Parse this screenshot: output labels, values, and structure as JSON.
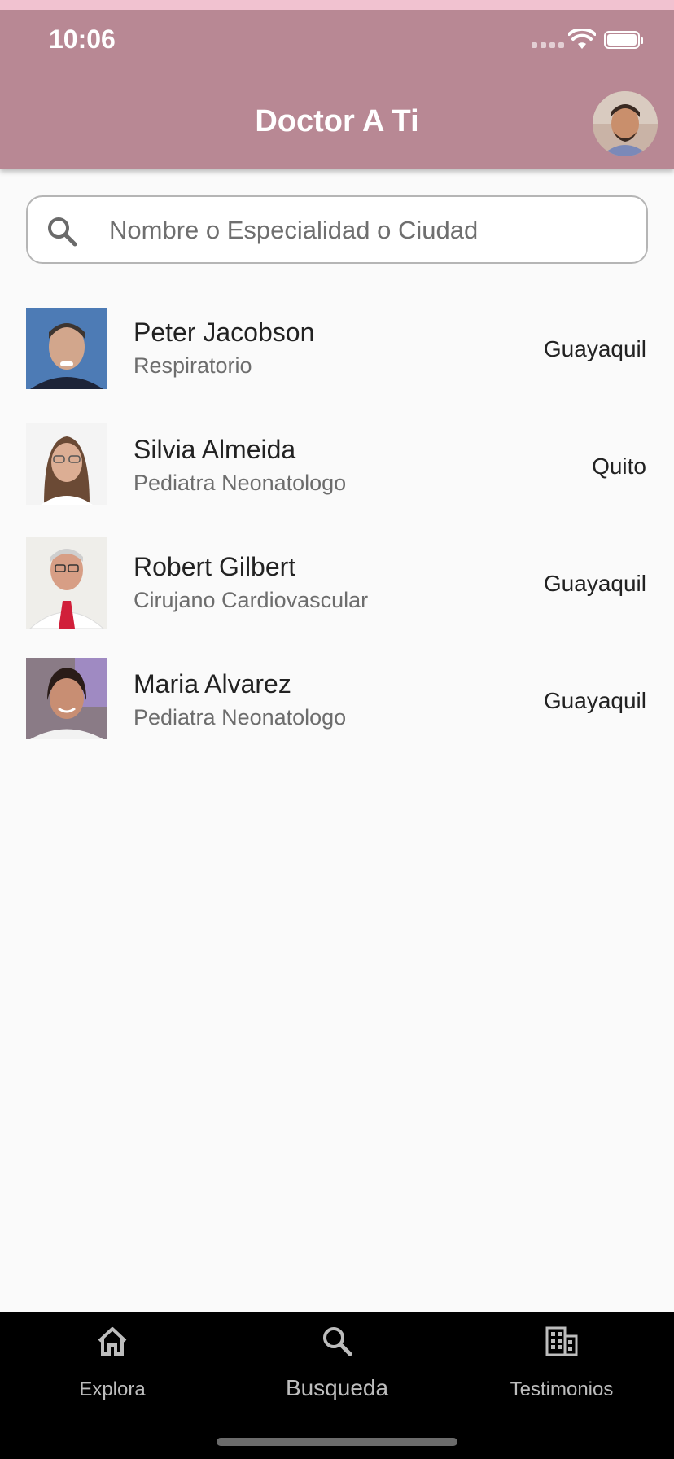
{
  "status_bar": {
    "time": "10:06"
  },
  "app_bar": {
    "title": "Doctor A Ti"
  },
  "search": {
    "placeholder": "Nombre o Especialidad o Ciudad"
  },
  "doctors": [
    {
      "name": "Peter Jacobson",
      "specialty": "Respiratorio",
      "city": "Guayaquil"
    },
    {
      "name": "Silvia Almeida",
      "specialty": "Pediatra Neonatologo",
      "city": "Quito"
    },
    {
      "name": "Robert Gilbert",
      "specialty": "Cirujano Cardiovascular",
      "city": "Guayaquil"
    },
    {
      "name": "Maria Alvarez",
      "specialty": "Pediatra Neonatologo",
      "city": "Guayaquil"
    }
  ],
  "bottom_nav": {
    "items": [
      {
        "label": "Explora",
        "icon": "home-icon"
      },
      {
        "label": "Busqueda",
        "icon": "search-icon"
      },
      {
        "label": "Testimonios",
        "icon": "building-icon"
      }
    ],
    "selected": "Busqueda"
  },
  "colors": {
    "app_bar": "#b88894",
    "background": "#fafafa",
    "nav_bg": "#000000"
  }
}
